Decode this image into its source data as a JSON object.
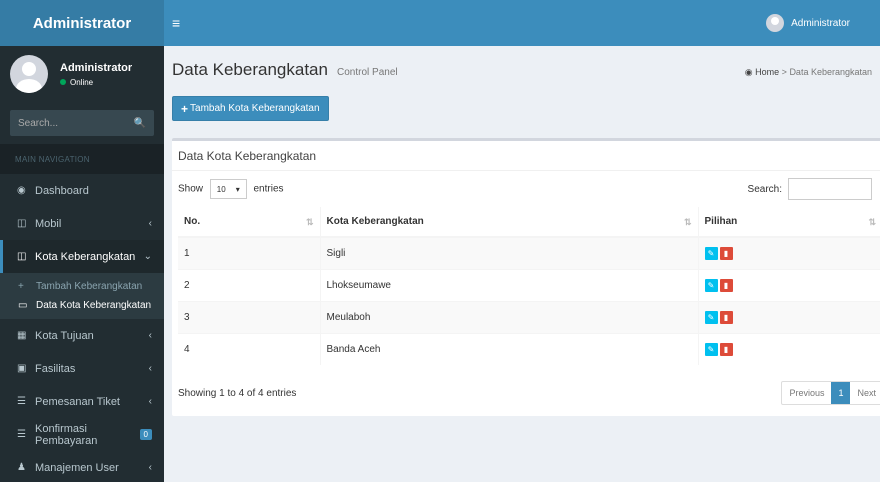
{
  "app": {
    "logo": "Administrator"
  },
  "user": {
    "name": "Administrator",
    "status": "Online"
  },
  "sidebar": {
    "search_placeholder": "Search...",
    "section_header": "MAIN NAVIGATION",
    "items": [
      {
        "label": "Dashboard",
        "icon": "dashboard-icon"
      },
      {
        "label": "Mobil",
        "icon": "car-icon"
      },
      {
        "label": "Kota Keberangkatan",
        "icon": "car-icon"
      },
      {
        "label": "Kota Tujuan",
        "icon": "building-icon"
      },
      {
        "label": "Fasilitas",
        "icon": "image-icon"
      },
      {
        "label": "Pemesanan Tiket",
        "icon": "list-icon"
      },
      {
        "label": "Konfirmasi Pembayaran",
        "icon": "list-icon",
        "badge": "0"
      },
      {
        "label": "Manajemen User",
        "icon": "user-icon"
      }
    ],
    "submenu": [
      {
        "label": "Tambah Keberangkatan"
      },
      {
        "label": "Data Kota Keberangkatan"
      }
    ]
  },
  "header": {
    "menu_icon": "hamburger-icon",
    "user_name": "Administrator"
  },
  "content": {
    "title": "Data Keberangkatan",
    "subtitle": "Control Panel",
    "breadcrumb": {
      "home": "Home",
      "current": "Data Keberangkatan"
    },
    "add_button": "Tambah Kota Keberangkatan",
    "box_title": "Data Kota Keberangkatan",
    "show_label": "Show",
    "show_value": "10",
    "entries_label": "entries",
    "search_label": "Search:",
    "table": {
      "headers": [
        "No.",
        "Kota Keberangkatan",
        "Pilihan"
      ],
      "rows": [
        {
          "no": "1",
          "kota": "Sigli"
        },
        {
          "no": "2",
          "kota": "Lhokseumawe"
        },
        {
          "no": "3",
          "kota": "Meulaboh"
        },
        {
          "no": "4",
          "kota": "Banda Aceh"
        }
      ]
    },
    "info": "Showing 1 to 4 of 4 entries",
    "pagination": {
      "previous": "Previous",
      "current": "1",
      "next": "Next"
    }
  },
  "colors": {
    "sidebar": "#222d32",
    "header": "#3c8dbc",
    "logo": "#357ca5",
    "edit": "#00c0ef",
    "delete": "#dd4b39"
  }
}
